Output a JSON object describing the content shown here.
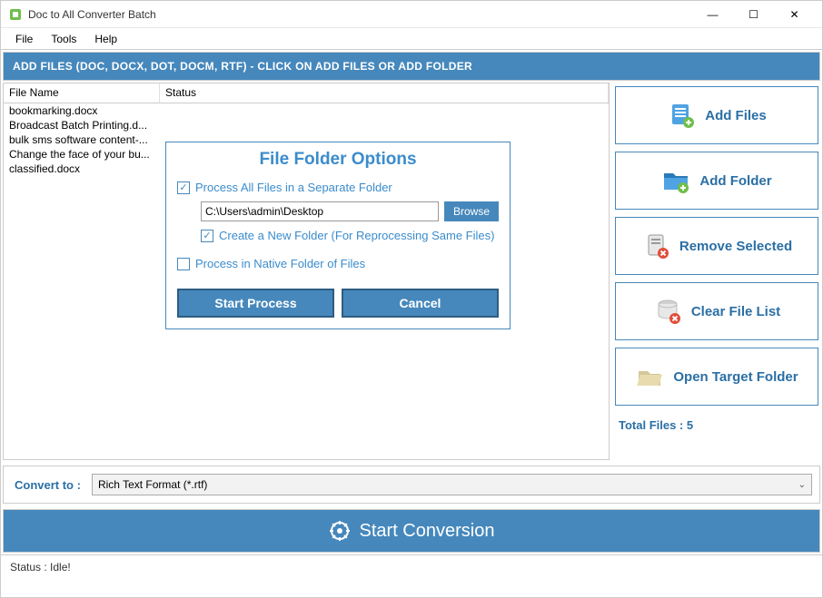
{
  "window": {
    "title": "Doc to All Converter Batch"
  },
  "menu": {
    "file": "File",
    "tools": "Tools",
    "help": "Help"
  },
  "banner": "ADD FILES (DOC, DOCX, DOT, DOCM, RTF) - CLICK ON ADD FILES OR ADD FOLDER",
  "columns": {
    "filename": "File Name",
    "status": "Status"
  },
  "files": [
    "bookmarking.docx",
    "Broadcast Batch Printing.d...",
    "bulk sms software content-...",
    "Change the face of your bu...",
    "classified.docx"
  ],
  "sidebar": {
    "addFiles": "Add Files",
    "addFolder": "Add Folder",
    "removeSelected": "Remove Selected",
    "clearList": "Clear File List",
    "openTarget": "Open Target Folder",
    "totalFiles": "Total Files : 5"
  },
  "dialog": {
    "title": "File Folder Options",
    "opt1": "Process All Files in a Separate Folder",
    "path": "C:\\Users\\admin\\Desktop",
    "browse": "Browse",
    "opt2": "Create a New Folder (For Reprocessing Same Files)",
    "opt3": "Process in Native Folder of Files",
    "start": "Start Process",
    "cancel": "Cancel"
  },
  "convert": {
    "label": "Convert to :",
    "value": "Rich Text Format (*.rtf)"
  },
  "startConversion": "Start Conversion",
  "status": "Status  :  Idle!"
}
